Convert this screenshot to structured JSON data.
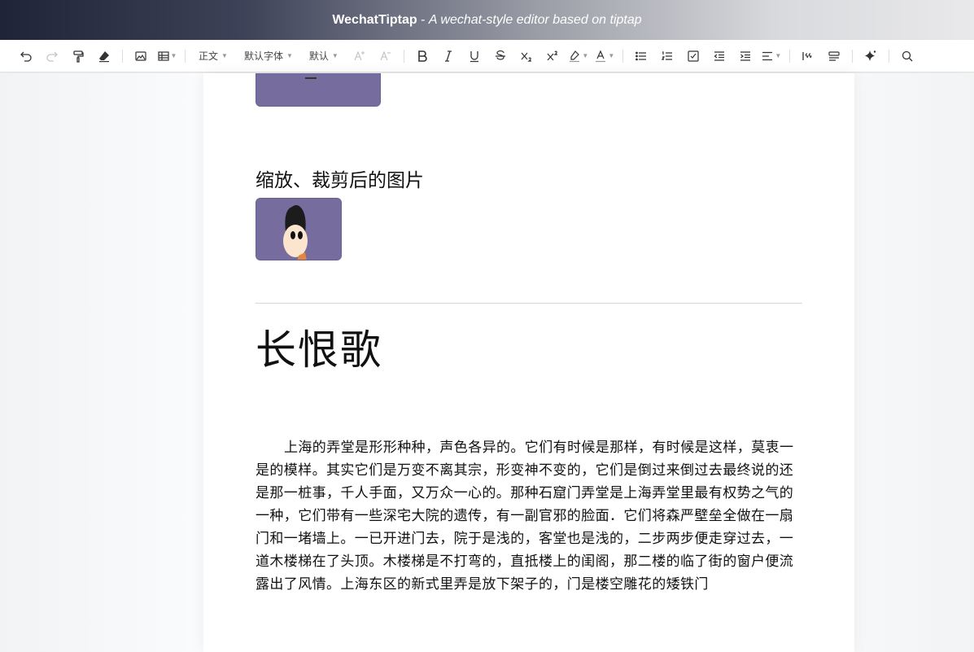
{
  "window": {
    "app_name": "WechatTiptap",
    "separator": " - ",
    "subtitle": "A wechat-style editor based on tiptap"
  },
  "toolbar": {
    "paragraph_select": "正文",
    "font_select": "默认字体",
    "size_select": "默认",
    "icons": [
      "undo-icon",
      "redo-icon",
      "format-painter-icon",
      "eraser-icon",
      "image-icon",
      "table-icon",
      "font-size-increase-icon",
      "font-size-decrease-icon",
      "bold-icon",
      "italic-icon",
      "underline-icon",
      "strikethrough-icon",
      "subscript-icon",
      "superscript-icon",
      "highlight-icon",
      "font-color-icon",
      "bullet-list-icon",
      "ordered-list-icon",
      "task-list-icon",
      "outdent-icon",
      "indent-icon",
      "align-icon",
      "blockquote-icon",
      "code-block-icon",
      "ai-sparkle-icon",
      "search-icon"
    ]
  },
  "document": {
    "image_caption": "缩放、裁剪后的图片",
    "heading": "长恨歌",
    "paragraph": "上海的弄堂是形形种种，声色各异的。它们有时候是那样，有时候是这样，莫衷一是的模样。其实它们是万变不离其宗，形变神不变的，它们是倒过来倒过去最终说的还是那一桩事，千人手面，又万众一心的。那种石窟门弄堂是上海弄堂里最有权势之气的一种，它们带有一些深宅大院的遗传，有一副官邪的脸面．它们将森严壁垒全做在一扇门和一堵墙上。一已开进门去，院于是浅的，客堂也是浅的，二步两步便走穿过去，一道木楼梯在了头顶。木楼梯是不打弯的，直抵楼上的闺阁，那二楼的临了街的窗户便流露出了风情。上海东区的新式里弄是放下架子的，门是楼空雕花的矮铁门"
  },
  "colors": {
    "image_bg": "#776c9e",
    "titlebar_dark": "#1f2437"
  }
}
